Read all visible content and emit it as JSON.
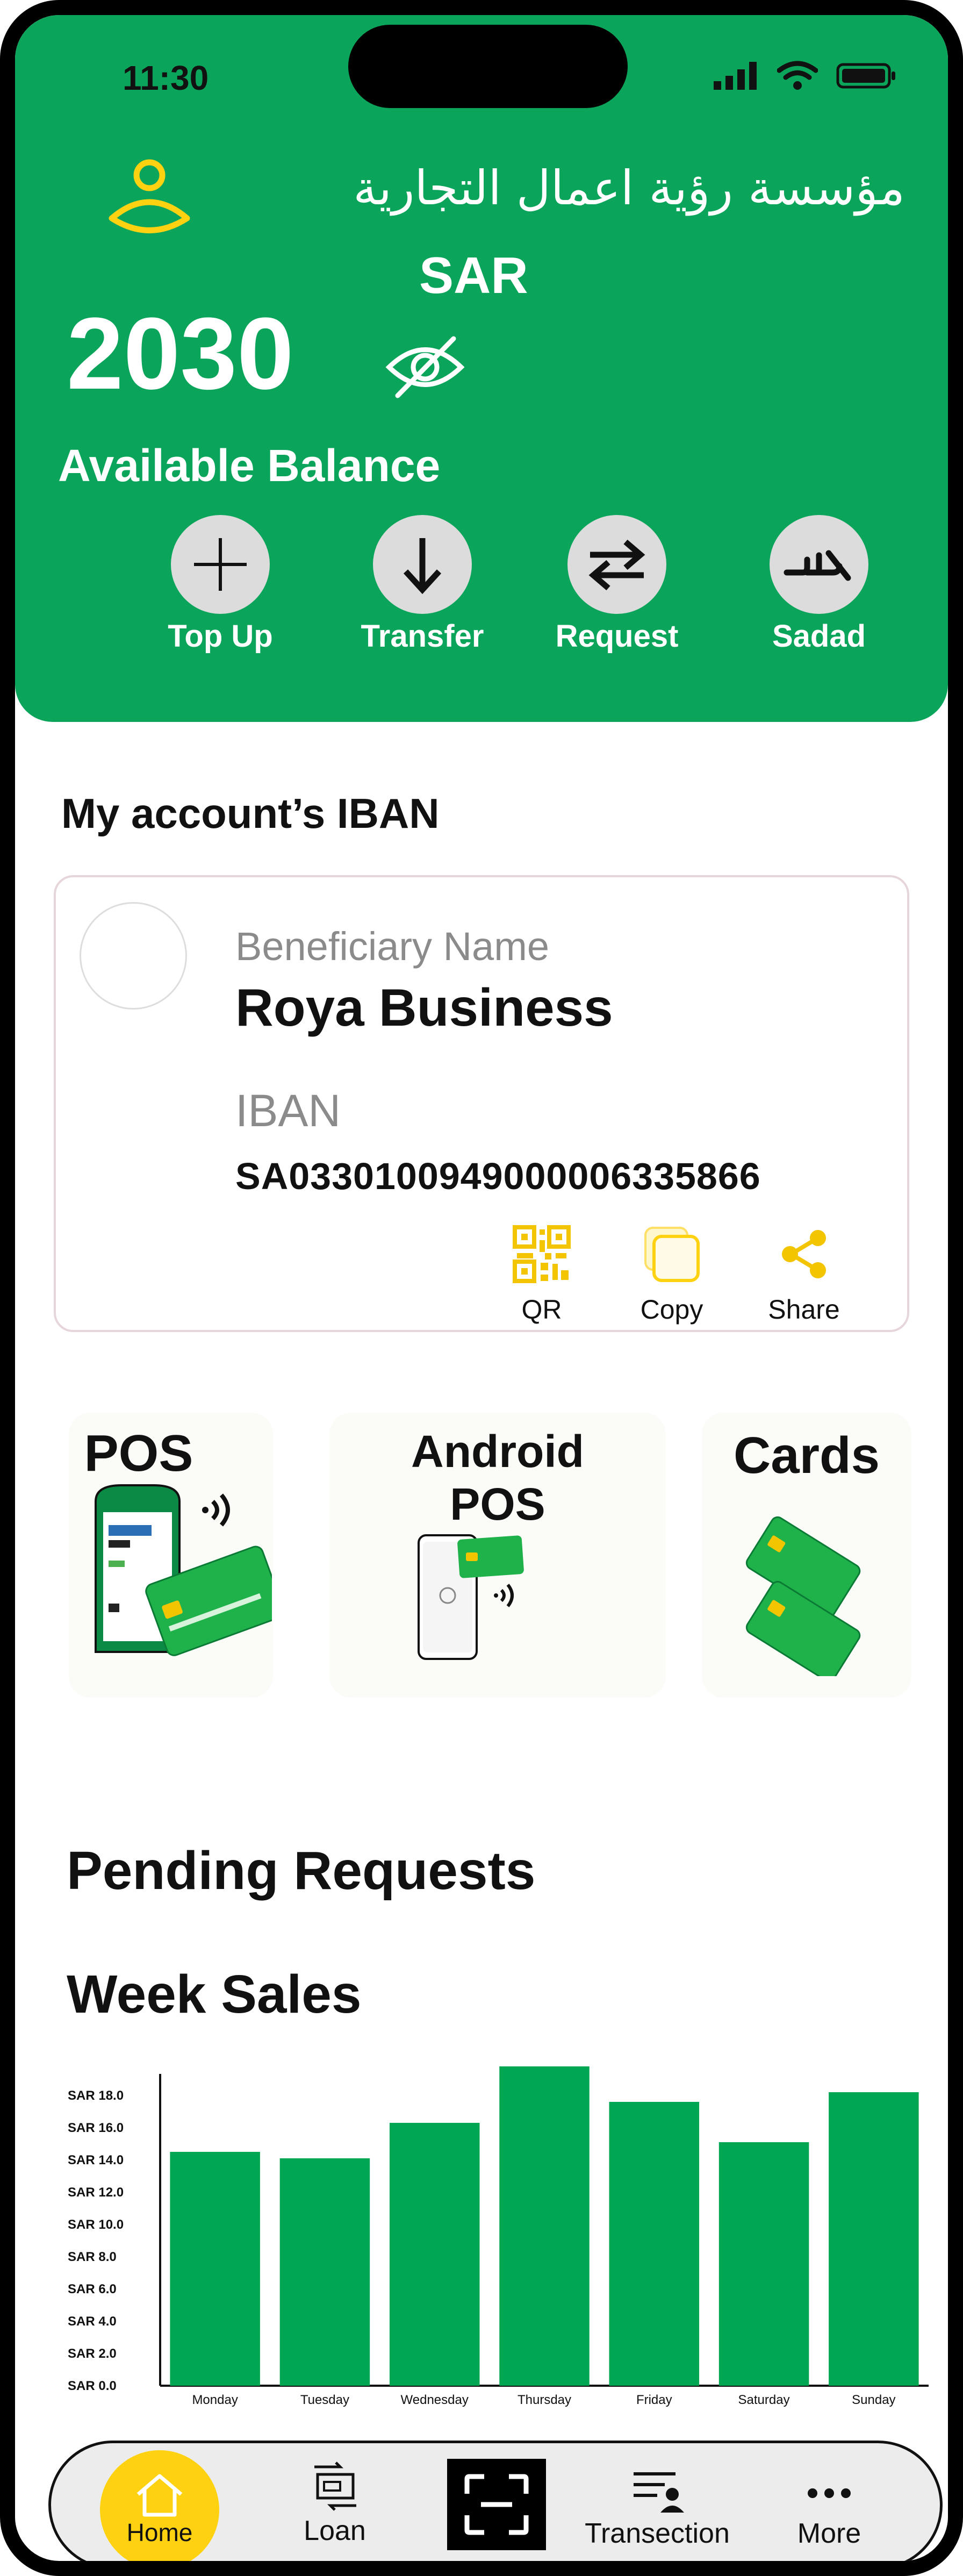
{
  "status_bar": {
    "time": "11:30"
  },
  "header": {
    "company_name": "مؤسسة رؤية اعمال التجارية",
    "currency": "SAR",
    "balance": "2030",
    "balance_label": "Available Balance",
    "actions": [
      {
        "label": "Top Up",
        "icon": "plus-icon"
      },
      {
        "label": "Transfer",
        "icon": "arrow-down-icon"
      },
      {
        "label": "Request",
        "icon": "swap-arrows-icon"
      },
      {
        "label": "Sadad",
        "icon": "sadad-logo-icon"
      }
    ]
  },
  "iban": {
    "title": "My account’s  IBAN",
    "beneficiary_label": "Beneficiary Name",
    "beneficiary_name": "Roya Business",
    "iban_label": "IBAN",
    "iban_value": "SA0330100949000006335866",
    "actions": [
      {
        "label": "QR",
        "icon": "qr-code-icon"
      },
      {
        "label": "Copy",
        "icon": "copy-icon"
      },
      {
        "label": "Share",
        "icon": "share-icon"
      }
    ]
  },
  "products": [
    {
      "title": "POS"
    },
    {
      "title_line1": "Android",
      "title_line2": "POS"
    },
    {
      "title": "Cards"
    }
  ],
  "sections": {
    "pending_title": "Pending Requests",
    "week_title": "Week  Sales"
  },
  "chart_data": {
    "type": "bar",
    "categories": [
      "Monday",
      "Tuesday",
      "Wednesday",
      "Thursday",
      "Friday",
      "Saturday",
      "Sunday"
    ],
    "values": [
      14.5,
      14.1,
      16.3,
      19.8,
      17.6,
      15.1,
      18.2
    ],
    "ylim": [
      0,
      19
    ],
    "yticks": [
      "SAR 0.0",
      "SAR 2.0",
      "SAR 4.0",
      "SAR 6.0",
      "SAR 8.0",
      "SAR 10.0",
      "SAR 12.0",
      "SAR 14.0",
      "SAR 16.0",
      "SAR 18.0"
    ],
    "ytick_values": [
      0,
      2,
      4,
      6,
      8,
      10,
      12,
      14,
      16,
      18
    ],
    "bar_color": "#00a651",
    "grid": false
  },
  "nav": {
    "items": [
      {
        "label": "Home",
        "icon": "home-icon",
        "active": true
      },
      {
        "label": "Loan",
        "icon": "loan-icon"
      },
      {
        "label": "",
        "icon": "scan-icon"
      },
      {
        "label": "Transection",
        "icon": "transaction-icon"
      },
      {
        "label": "More",
        "icon": "more-dots-icon"
      }
    ]
  },
  "colors": {
    "brand_green": "#0aa55a",
    "accent_yellow": "#ffd211",
    "chart_green": "#00a651"
  }
}
